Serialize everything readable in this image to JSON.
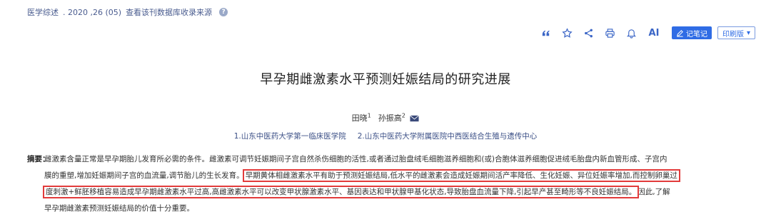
{
  "source_line": {
    "journal": "医学综述",
    "issue": ". 2020 ,26 (05)",
    "database_link": "查看该刊数据库收录来源",
    "help_icon": "?"
  },
  "toolbar": {
    "quote_icon": "quote-icon",
    "star_icon": "star-icon",
    "share_icon": "share-icon",
    "print_icon": "printer-icon",
    "bell_icon": "bell-icon",
    "ai_label": "AI",
    "note_label": "记笔记",
    "print_version_label": "印刷版",
    "accent_color": "#2f6ce5"
  },
  "article": {
    "title": "早孕期雌激素水平预测妊娠结局的研究进展",
    "authors": [
      {
        "name": "田晓",
        "affil": "1"
      },
      {
        "name": "孙振高",
        "affil": "2"
      }
    ],
    "affiliations": [
      "1.山东中医药大学第一临床医学院",
      "2.山东中医药大学附属医院中西医结合生殖与遗传中心"
    ]
  },
  "abstract": {
    "label": "摘要：",
    "line1": "雌激素含量正常是早孕期胎儿发育所必需的条件。雌激素可调节妊娠期间子宫自然杀伤细胞的活性,或者通过胎盘绒毛细胞滋养细胞和(或)合胞体滋养细胞促进绒毛胎盘内新血管形成、子宫内",
    "line2_pre": "膜的重塑,增加妊娠期间子宫的血流量,调节胎儿的生长发育。",
    "line2_hl": "早期黄体相雌激素水平有助于预测妊娠结局,低水平的雌激素会造成妊娠期间活产率降低、生化妊娠、异位妊娠率增加,而控制卵巢过",
    "line3_hl": "度刺激+鲜胚移植容易造成早孕期雌激素水平过高,高雌激素水平可以改变甲状腺激素水平、基因表达和甲状腺甲基化状态,导致胎盘血流量下降,引起早产甚至畸形等不良妊娠结局。",
    "line3_post": "因此,了解",
    "line4": "早孕期雌激素预测妊娠结局的价值十分重要。"
  }
}
